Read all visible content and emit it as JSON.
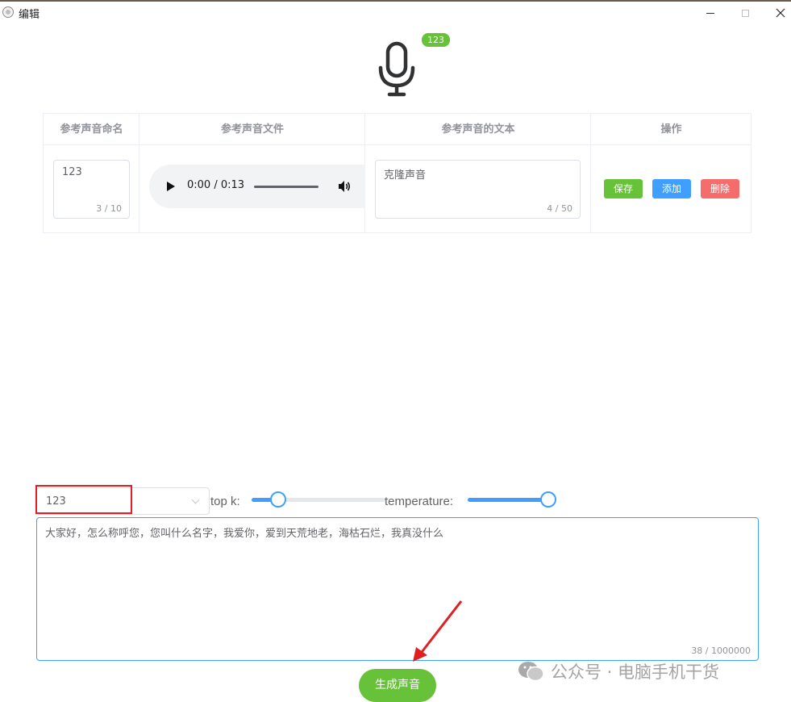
{
  "window": {
    "title": "编辑"
  },
  "badge": {
    "count": "123"
  },
  "table": {
    "headers": [
      "参考声音命名",
      "参考声音文件",
      "参考声音的文本",
      "操作"
    ],
    "row": {
      "name_value": "123",
      "name_count": "3 / 10",
      "audio_time": "0:00 / 0:13",
      "text_value": "克隆声音",
      "text_count": "4 / 50",
      "actions": {
        "save": "保存",
        "add": "添加",
        "delete": "删除"
      }
    }
  },
  "controls": {
    "voice_select": "123",
    "topk_label": "top k:",
    "temperature_label": "temperature:",
    "topk_fraction": 0.2,
    "temperature_fraction": 1.0
  },
  "input": {
    "text": "大家好，怎么称呼您，您叫什么名字，我爱你，爱到天荒地老，海枯石烂，我真没什么",
    "count": "38 / 1000000"
  },
  "generate_button": "生成声音",
  "watermark": "公众号 · 电脑手机干货",
  "colors": {
    "success": "#67c23a",
    "primary": "#409eff",
    "danger": "#f56c6c",
    "highlight": "#e02020"
  }
}
